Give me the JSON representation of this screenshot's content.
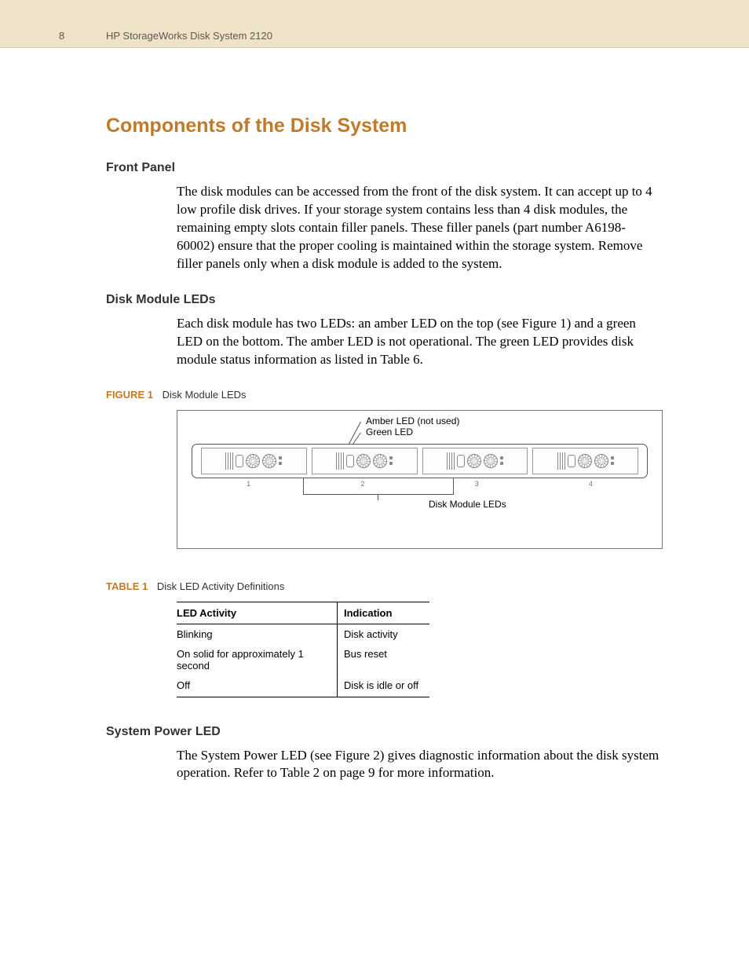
{
  "header": {
    "page_number": "8",
    "running_title": "HP StorageWorks Disk System 2120"
  },
  "title": "Components of the Disk System",
  "sections": {
    "front_panel": {
      "heading": "Front Panel",
      "body": "The disk modules can be accessed from the front of the disk system. It can accept up to 4 low profile disk drives. If your storage system contains less than 4 disk modules, the remaining empty slots contain filler panels. These filler panels (part number A6198-60002) ensure that the proper cooling is maintained within the storage system. Remove filler panels only when a disk module is added to the system."
    },
    "disk_module_leds": {
      "heading": "Disk Module LEDs",
      "body": "Each disk module has two LEDs: an amber LED on the top (see Figure 1) and a green LED on the bottom. The amber LED is not operational. The green LED provides disk module status information as listed in Table 6."
    },
    "system_power_led": {
      "heading": "System Power LED",
      "body": "The System Power LED (see Figure 2) gives diagnostic information about the disk system operation. Refer to Table 2 on page 9 for more information."
    }
  },
  "figure1": {
    "caption_key": "FIGURE 1",
    "caption_text": "Disk Module LEDs",
    "label_amber": "Amber LED (not used)",
    "label_green": "Green LED",
    "label_bottom": "Disk Module LEDs",
    "slots": [
      "1",
      "2",
      "3",
      "4"
    ]
  },
  "table1": {
    "caption_key": "TABLE 1",
    "caption_text": "Disk LED Activity Definitions",
    "headers": [
      "LED Activity",
      "Indication"
    ],
    "rows": [
      [
        "Blinking",
        "Disk activity"
      ],
      [
        "On solid for approximately 1 second",
        "Bus reset"
      ],
      [
        "Off",
        "Disk is idle or off"
      ]
    ]
  }
}
